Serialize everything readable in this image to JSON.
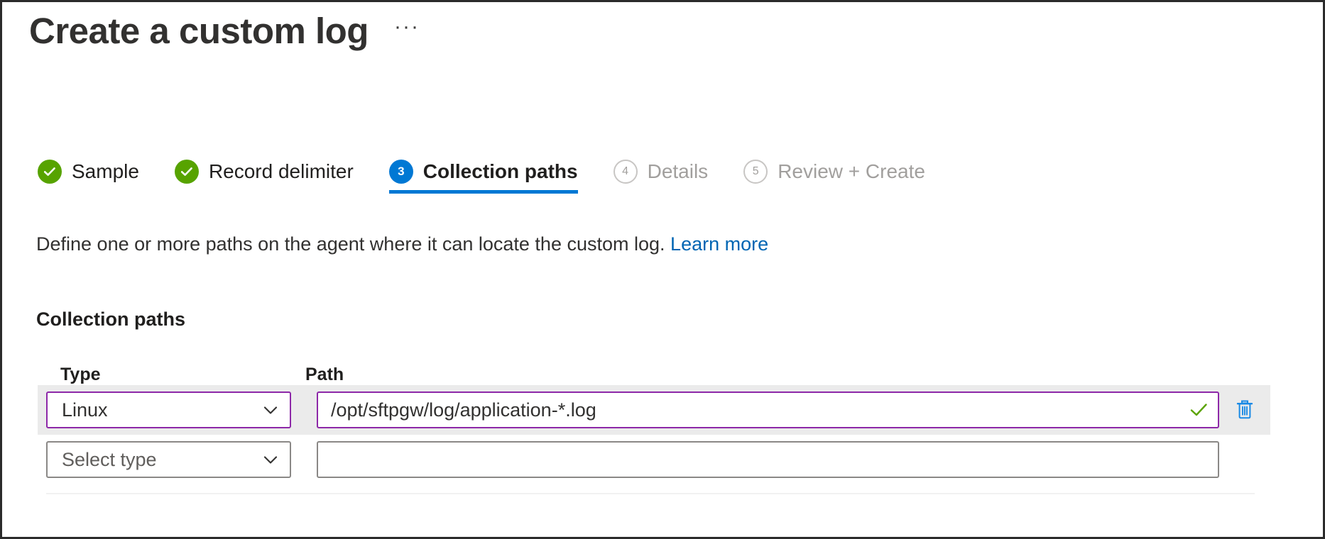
{
  "page": {
    "title": "Create a custom log",
    "more_menu_label": "···",
    "more_menu_icon": "ellipsis-icon"
  },
  "wizard": {
    "steps": [
      {
        "number": "1",
        "label": "Sample",
        "state": "done",
        "icon": "check-icon"
      },
      {
        "number": "2",
        "label": "Record delimiter",
        "state": "done",
        "icon": "check-icon"
      },
      {
        "number": "3",
        "label": "Collection paths",
        "state": "active",
        "icon": "step-number"
      },
      {
        "number": "4",
        "label": "Details",
        "state": "todo",
        "icon": "step-number"
      },
      {
        "number": "5",
        "label": "Review + Create",
        "state": "todo",
        "icon": "step-number"
      }
    ]
  },
  "description": {
    "text": "Define one or more paths on the agent where it can locate the custom log.",
    "link_label": "Learn more"
  },
  "collection_paths": {
    "section_title": "Collection paths",
    "columns": {
      "type": "Type",
      "path": "Path"
    },
    "rows": [
      {
        "type_value": "Linux",
        "type_is_placeholder": false,
        "type_focused": true,
        "path_value": "/opt/sftpgw/log/application-*.log",
        "path_placeholder": "",
        "path_focused": true,
        "path_valid": true,
        "validation_icon": "checkmark-icon",
        "delete_icon": "trash-icon",
        "highlighted": true
      },
      {
        "type_value": "",
        "type_placeholder": "Select type",
        "type_is_placeholder": true,
        "type_focused": false,
        "path_value": "",
        "path_placeholder": "",
        "path_focused": false,
        "path_valid": false,
        "validation_icon": "",
        "delete_icon": "",
        "highlighted": false
      }
    ],
    "dropdown_icon": "chevron-down-icon"
  },
  "colors": {
    "accent_blue": "#0078d4",
    "link_blue": "#0065b3",
    "success_green": "#57a300",
    "check_green": "#5ba300",
    "focus_purple": "#8d28a8",
    "trash_blue": "#1a8ae5",
    "row_highlight": "#ebebeb",
    "text_primary": "#201f1e",
    "text_disabled": "#a19f9d",
    "border_grey": "#8a8886"
  }
}
